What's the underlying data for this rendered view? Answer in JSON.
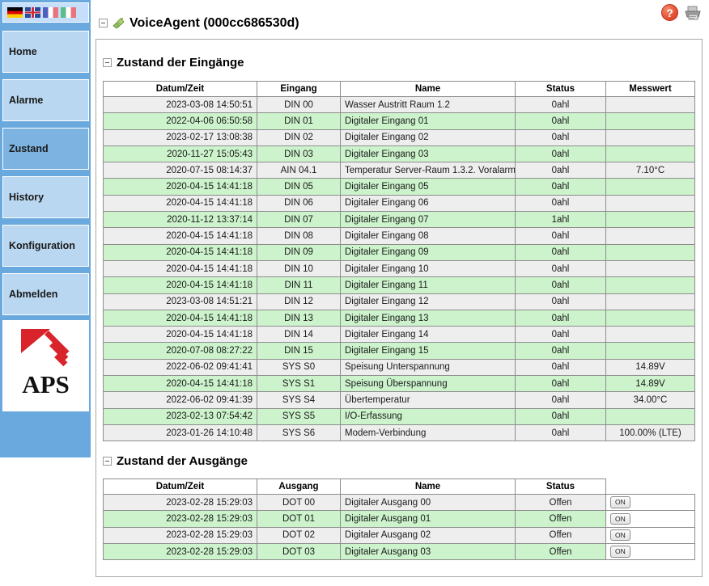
{
  "sidebar": {
    "flags": [
      {
        "name": "flag-germany",
        "code": "de",
        "title": "Deutsch"
      },
      {
        "name": "flag-united-kingdom",
        "code": "gb",
        "title": "English"
      },
      {
        "name": "flag-france",
        "code": "fr",
        "title": "Français"
      },
      {
        "name": "flag-italy",
        "code": "it",
        "title": "Italiano"
      }
    ],
    "items": [
      {
        "label": "Home",
        "active": false
      },
      {
        "label": "Alarme",
        "active": false
      },
      {
        "label": "Zustand",
        "active": true
      },
      {
        "label": "History",
        "active": false
      },
      {
        "label": "Konfiguration",
        "active": false
      },
      {
        "label": "Abmelden",
        "active": false
      }
    ],
    "logo_text": "APS"
  },
  "topbar": {
    "help_label": "?",
    "help_icon": "help-circle-icon",
    "print_icon": "printer-icon"
  },
  "header": {
    "title": "VoiceAgent (000cc686530d)",
    "device_icon": "plug-connector-icon",
    "collapse_icon": "collapse-minus-box"
  },
  "sections": {
    "inputs": {
      "title": "Zustand der Eingänge",
      "columns": [
        "Datum/Zeit",
        "Eingang",
        "Name",
        "Status",
        "Messwert"
      ],
      "rows": [
        [
          "2023-03-08 14:50:51",
          "DIN 00",
          "Wasser Austritt Raum 1.2",
          "0ahl",
          ""
        ],
        [
          "2022-04-06 06:50:58",
          "DIN 01",
          "Digitaler Eingang 01",
          "0ahl",
          ""
        ],
        [
          "2023-02-17 13:08:38",
          "DIN 02",
          "Digitaler Eingang 02",
          "0ahl",
          ""
        ],
        [
          "2020-11-27 15:05:43",
          "DIN 03",
          "Digitaler Eingang 03",
          "0ahl",
          ""
        ],
        [
          "2020-07-15 08:14:37",
          "AIN 04.1",
          "Temperatur Server-Raum 1.3.2. Voralarm",
          "0ahl",
          "7.10°C"
        ],
        [
          "2020-04-15 14:41:18",
          "DIN 05",
          "Digitaler Eingang 05",
          "0ahl",
          ""
        ],
        [
          "2020-04-15 14:41:18",
          "DIN 06",
          "Digitaler Eingang 06",
          "0ahl",
          ""
        ],
        [
          "2020-11-12 13:37:14",
          "DIN 07",
          "Digitaler Eingang 07",
          "1ahl",
          ""
        ],
        [
          "2020-04-15 14:41:18",
          "DIN 08",
          "Digitaler Eingang 08",
          "0ahl",
          ""
        ],
        [
          "2020-04-15 14:41:18",
          "DIN 09",
          "Digitaler Eingang 09",
          "0ahl",
          ""
        ],
        [
          "2020-04-15 14:41:18",
          "DIN 10",
          "Digitaler Eingang 10",
          "0ahl",
          ""
        ],
        [
          "2020-04-15 14:41:18",
          "DIN 11",
          "Digitaler Eingang 11",
          "0ahl",
          ""
        ],
        [
          "2023-03-08 14:51:21",
          "DIN 12",
          "Digitaler Eingang 12",
          "0ahl",
          ""
        ],
        [
          "2020-04-15 14:41:18",
          "DIN 13",
          "Digitaler Eingang 13",
          "0ahl",
          ""
        ],
        [
          "2020-04-15 14:41:18",
          "DIN 14",
          "Digitaler Eingang 14",
          "0ahl",
          ""
        ],
        [
          "2020-07-08 08:27:22",
          "DIN 15",
          "Digitaler Eingang 15",
          "0ahl",
          ""
        ],
        [
          "2022-06-02 09:41:41",
          "SYS S0",
          "Speisung Unterspannung",
          "0ahl",
          "14.89V"
        ],
        [
          "2020-04-15 14:41:18",
          "SYS S1",
          "Speisung Überspannung",
          "0ahl",
          "14.89V"
        ],
        [
          "2022-06-02 09:41:39",
          "SYS S4",
          "Übertemperatur",
          "0ahl",
          "34.00°C"
        ],
        [
          "2023-02-13 07:54:42",
          "SYS S5",
          "I/O-Erfassung",
          "0ahl",
          ""
        ],
        [
          "2023-01-26 14:10:48",
          "SYS S6",
          "Modem-Verbindung",
          "0ahl",
          "100.00% (LTE)"
        ]
      ]
    },
    "outputs": {
      "title": "Zustand der Ausgänge",
      "columns": [
        "Datum/Zeit",
        "Ausgang",
        "Name",
        "Status"
      ],
      "button_label": "ON",
      "rows": [
        [
          "2023-02-28 15:29:03",
          "DOT 00",
          "Digitaler Ausgang 00",
          "Offen"
        ],
        [
          "2023-02-28 15:29:03",
          "DOT 01",
          "Digitaler Ausgang 01",
          "Offen"
        ],
        [
          "2023-02-28 15:29:03",
          "DOT 02",
          "Digitaler Ausgang 02",
          "Offen"
        ],
        [
          "2023-02-28 15:29:03",
          "DOT 03",
          "Digitaler Ausgang 03",
          "Offen"
        ]
      ]
    }
  },
  "colors": {
    "sidebar_bg": "#6aa9dd",
    "nav_item": "#b9d7f0",
    "nav_item_active": "#7cb3e0",
    "row_odd": "#eeeeee",
    "row_even": "#ccf3cc",
    "logo_red": "#d9242b",
    "help_red": "#e0472b"
  }
}
